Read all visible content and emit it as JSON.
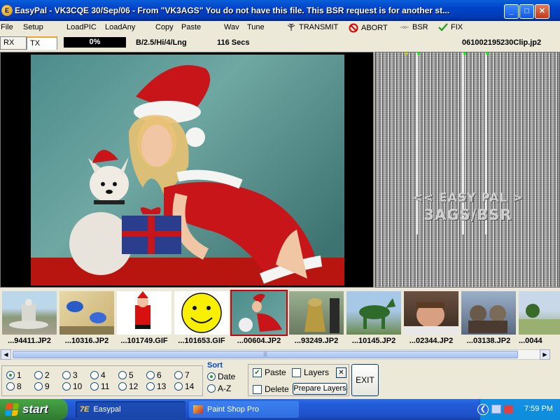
{
  "window": {
    "title": "EasyPal  -  VK3CQE  30/Sep/06   -  From \"VK3AGS\" You do not have this file. This BSR request is for another st...",
    "minimize_glyph": "_",
    "maximize_glyph": "□",
    "close_glyph": "✕"
  },
  "menu": {
    "file": "File",
    "setup": "Setup",
    "loadpic": "LoadPIC",
    "loadany": "LoadAny",
    "copy": "Copy",
    "paste": "Paste",
    "wav": "Wav",
    "tune": "Tune",
    "transmit": "TRANSMIT",
    "abort": "ABORT",
    "bsr": "BSR",
    "fix": "FIX"
  },
  "status": {
    "tab_rx": "RX",
    "tab_tx": "TX",
    "progress_text": "0%",
    "progress_value": 0,
    "mode": "B/2.5/Hi/4/Lng",
    "duration": "116 Secs",
    "filename": "061002195230Clip.jp2"
  },
  "waterfall": {
    "text_line1": "<< EASY PAL >",
    "text_line2": "3AGS/BSR"
  },
  "thumbnails": [
    {
      "label": "...94411.JP2",
      "image": "fountain"
    },
    {
      "label": "...10316.JP2",
      "image": "blue-birds"
    },
    {
      "label": "...101749.GIF",
      "image": "santa-cartoon"
    },
    {
      "label": "...101653.GIF",
      "image": "smiley"
    },
    {
      "label": "...00604.JP2",
      "image": "santa-girl",
      "selected": true
    },
    {
      "label": "...93249.JP2",
      "image": "dalek"
    },
    {
      "label": "...10145.JP2",
      "image": "topiary-horse"
    },
    {
      "label": "...02344.JP2",
      "image": "man-face"
    },
    {
      "label": "...03138.JP2",
      "image": "kittens"
    },
    {
      "label": "...0044",
      "image": "field"
    }
  ],
  "controls": {
    "radios": [
      {
        "label": "1",
        "selected": true
      },
      {
        "label": "2"
      },
      {
        "label": "3"
      },
      {
        "label": "4"
      },
      {
        "label": "5"
      },
      {
        "label": "6"
      },
      {
        "label": "7"
      },
      {
        "label": "8"
      },
      {
        "label": "9"
      },
      {
        "label": "10"
      },
      {
        "label": "11"
      },
      {
        "label": "12"
      },
      {
        "label": "13"
      },
      {
        "label": "14"
      }
    ],
    "sort_label": "Sort",
    "sort_date": "Date",
    "sort_az": "A-Z",
    "paste_label": "Paste",
    "paste_checked": true,
    "layers_label": "Layers",
    "layers_checked": false,
    "clear_glyph": "✕",
    "delete_label": "Delete",
    "delete_checked": false,
    "prepare_layers": "Prepare Layers",
    "exit": "EXIT"
  },
  "taskbar": {
    "start": "start",
    "item1": "Easypal",
    "item2": "Paint Shop Pro",
    "clock": "7:59 PM"
  },
  "colors": {
    "titlebar": "#0042c8",
    "taskbar": "#245edb",
    "start": "#3b8e3b",
    "selected_thumb": "#d40000"
  }
}
